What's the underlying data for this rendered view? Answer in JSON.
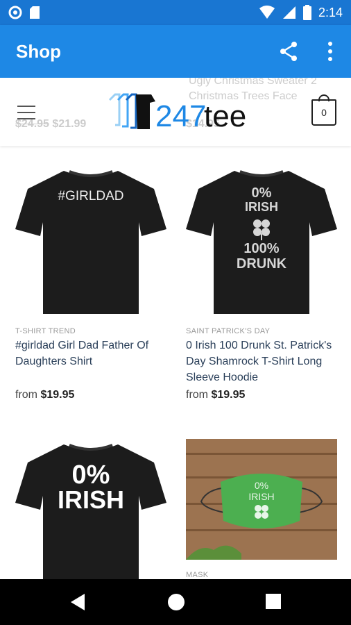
{
  "status_bar": {
    "time": "2:14"
  },
  "app_bar": {
    "title": "Shop"
  },
  "header": {
    "brand_digits": "247",
    "brand_word": "tee",
    "cart_count": "0",
    "ghost_price_old": "$24.95",
    "ghost_price_new": "$21.99",
    "ghost_title": "Ugly Christmas Sweater 2 Christmas Trees Face",
    "ghost_price_right": "$14.95"
  },
  "products": [
    {
      "shirt_text": "#GIRLDAD",
      "category": "T-SHIRT TREND",
      "name": "#girldad Girl Dad Father Of Daughters Shirt",
      "price_prefix": "from",
      "price": "$19.95"
    },
    {
      "shirt_text_1": "0%",
      "shirt_text_2": "IRISH",
      "shirt_text_3": "100%",
      "shirt_text_4": "DRUNK",
      "category": "SAINT PATRICK'S DAY",
      "name": "0 Irish 100 Drunk St. Patrick's Day Shamrock T-Shirt Long Sleeve Hoodie",
      "price_prefix": "from",
      "price": "$19.95"
    },
    {
      "shirt_text_1": "0%",
      "shirt_text_2": "IRISH"
    },
    {
      "mask_text_1": "0%",
      "mask_text_2": "IRISH",
      "category": "MASK"
    }
  ],
  "colors": {
    "status_bar": "#1976d2",
    "app_bar": "#1e88e5",
    "brand_blue": "#1e88e5",
    "shirt": "#1c1c1c",
    "mask": "#4caf50"
  }
}
